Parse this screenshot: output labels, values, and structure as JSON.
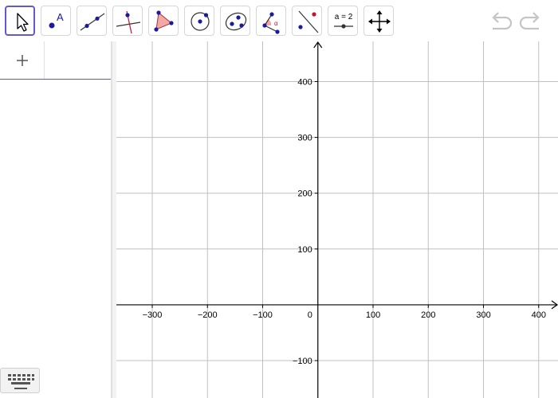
{
  "app": {
    "toolbar": {
      "tools": [
        {
          "name": "move-tool",
          "icon": "cursor-arrow-icon",
          "selected": true
        },
        {
          "name": "point-tool",
          "icon": "point-with-label-icon",
          "label": "A"
        },
        {
          "name": "line-tool",
          "icon": "line-through-two-points-icon"
        },
        {
          "name": "perpendicular-line-tool",
          "icon": "perpendicular-line-icon"
        },
        {
          "name": "polygon-tool",
          "icon": "polygon-triangle-icon"
        },
        {
          "name": "circle-tool",
          "icon": "circle-with-center-icon"
        },
        {
          "name": "ellipse-tool",
          "icon": "ellipse-icon"
        },
        {
          "name": "angle-tool",
          "icon": "angle-icon",
          "label": "α"
        },
        {
          "name": "reflect-tool",
          "icon": "reflect-about-line-icon"
        },
        {
          "name": "slider-tool",
          "icon": "slider-icon",
          "label": "a = 2"
        },
        {
          "name": "move-graphics-tool",
          "icon": "four-way-arrow-icon"
        }
      ],
      "undo_icon": "undo-icon",
      "redo_icon": "redo-icon"
    },
    "algebra_view": {
      "add_icon": "plus-icon"
    },
    "keyboard_icon": "keyboard-icon"
  },
  "chart_data": {
    "type": "axes",
    "xlim": [
      -365,
      435
    ],
    "ylim": [
      -167,
      472
    ],
    "x_ticks": [
      -300,
      -200,
      -100,
      0,
      100,
      200,
      300,
      400
    ],
    "y_ticks": [
      -100,
      100,
      200,
      300,
      400
    ],
    "x_tick_labels": [
      "−300",
      "−200",
      "−100",
      "0",
      "100",
      "200",
      "300",
      "400"
    ],
    "y_tick_labels": [
      "−100",
      "100",
      "200",
      "300",
      "400"
    ],
    "grid": true,
    "grid_color": "#c0c0c0",
    "axis_color": "#000000"
  }
}
